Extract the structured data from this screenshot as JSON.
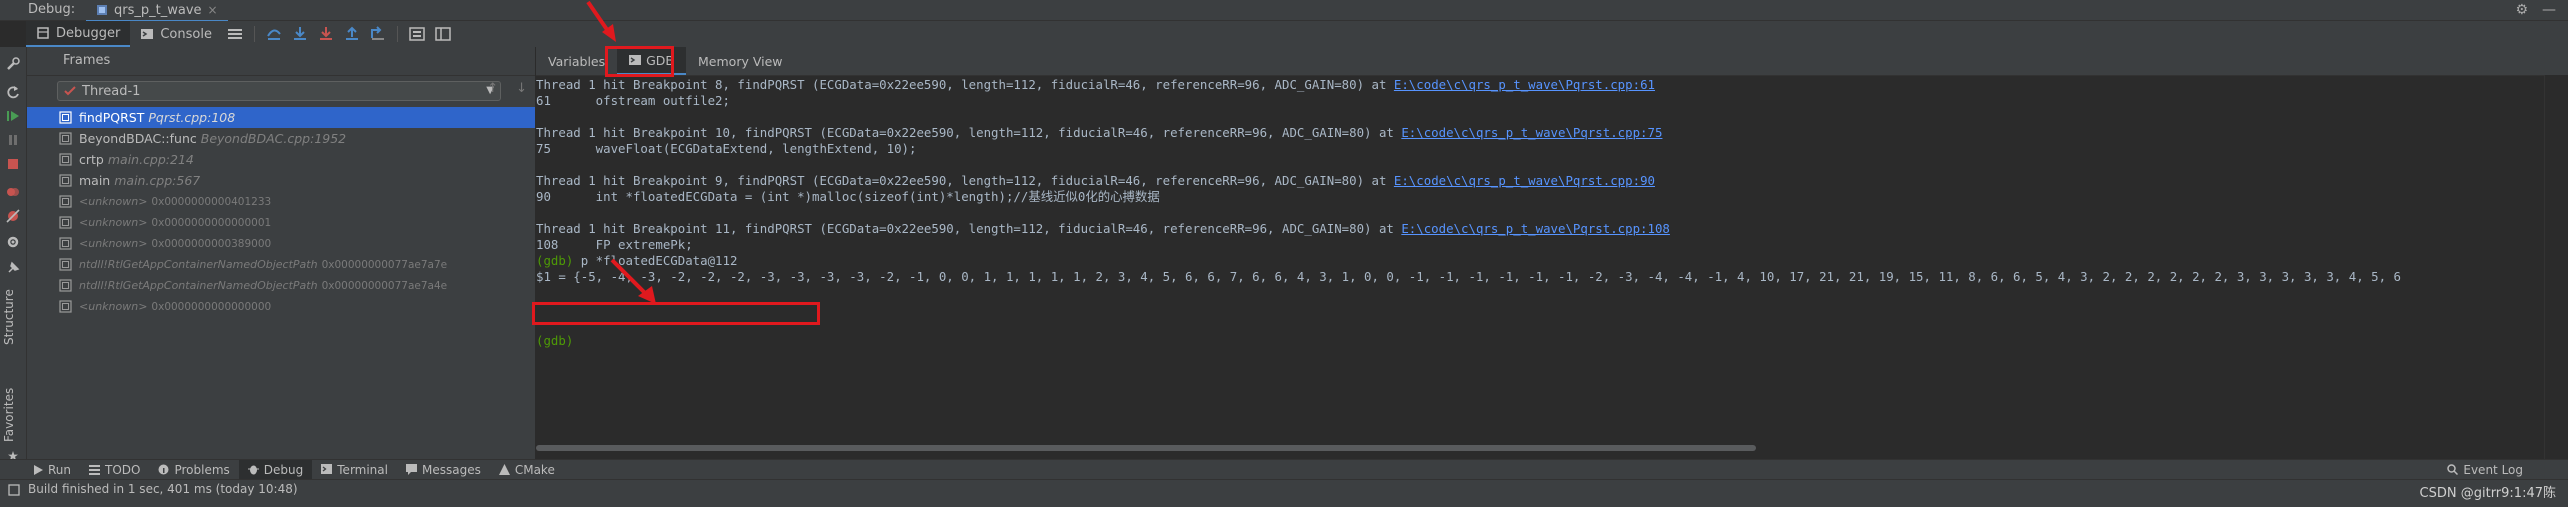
{
  "titlebar": {
    "debug_label": "Debug:",
    "tab_label": "qrs_p_t_wave",
    "tab_close": "×"
  },
  "toolbar": {
    "debugger_tab": "Debugger",
    "console_tab": "Console"
  },
  "frames_panel": {
    "header": "Frames",
    "thread_label": "Thread-1",
    "frames": [
      {
        "name": "findPQRST",
        "loc": "Pqrst.cpp:108",
        "selected": true
      },
      {
        "name": "BeyondBDAC::func",
        "loc": "BeyondBDAC.cpp:1952"
      },
      {
        "name": "crtp",
        "loc": "main.cpp:214"
      },
      {
        "name": "main",
        "loc": "main.cpp:567"
      },
      {
        "name": "<unknown>",
        "loc": "0x0000000000401233"
      },
      {
        "name": "<unknown>",
        "loc": "0x0000000000000001"
      },
      {
        "name": "<unknown>",
        "loc": "0x0000000000389000"
      },
      {
        "name": "ntdll!RtlGetAppContainerNamedObjectPath",
        "loc": "0x00000000077ae7a7e"
      },
      {
        "name": "ntdll!RtlGetAppContainerNamedObjectPath",
        "loc": "0x00000000077ae7a4e"
      },
      {
        "name": "<unknown>",
        "loc": "0x0000000000000000"
      }
    ]
  },
  "sidebar": {
    "structure_label": "Structure",
    "favorites_label": "Favorites"
  },
  "subtabs": {
    "variables": "Variables",
    "gdb": "GDB",
    "memory_view": "Memory View"
  },
  "console": {
    "lines": [
      {
        "text": "Thread 1 hit Breakpoint 8, findPQRST (ECGData=0x22ee590, length=112, fiducialR=46, referenceRR=96, ADC_GAIN=80) at ",
        "link": "E:\\code\\c\\qrs_p_t_wave\\Pqrst.cpp:61"
      },
      {
        "text": "61      ofstream outfile2;"
      },
      {
        "text": ""
      },
      {
        "text": "Thread 1 hit Breakpoint 10, findPQRST (ECGData=0x22ee590, length=112, fiducialR=46, referenceRR=96, ADC_GAIN=80) at ",
        "link": "E:\\code\\c\\qrs_p_t_wave\\Pqrst.cpp:75"
      },
      {
        "text": "75      waveFloat(ECGDataExtend, lengthExtend, 10);"
      },
      {
        "text": ""
      },
      {
        "text": "Thread 1 hit Breakpoint 9, findPQRST (ECGData=0x22ee590, length=112, fiducialR=46, referenceRR=96, ADC_GAIN=80) at ",
        "link": "E:\\code\\c\\qrs_p_t_wave\\Pqrst.cpp:90"
      },
      {
        "text": "90      int *floatedECGData = (int *)malloc(sizeof(int)*length);//基线近似0化的心搏数据"
      },
      {
        "text": ""
      },
      {
        "text": "Thread 1 hit Breakpoint 11, findPQRST (ECGData=0x22ee590, length=112, fiducialR=46, referenceRR=96, ADC_GAIN=80) at ",
        "link": "E:\\code\\c\\qrs_p_t_wave\\Pqrst.cpp:108"
      },
      {
        "text": "108     FP extremePk;"
      },
      {
        "prompt": "(gdb) ",
        "text": "p *floatedECGData@112"
      },
      {
        "text": "$1 = {-5, -4, -3, -2, -2, -2, -3, -3, -3, -3, -2, -1, 0, 0, 1, 1, 1, 1, 1, 2, 3, 4, 5, 6, 6, 7, 6, 6, 4, 3, 1, 0, 0, -1, -1, -1, -1, -1, -1, -2, -3, -4, -4, -1, 4, 10, 17, 21, 21, 19, 15, 11, 8, 6, 6, 5, 4, 3, 2, 2, 2, 2, 2, 2, 3, 3, 3, 3, 3, 4, 5, 6"
      },
      {
        "text": ""
      },
      {
        "text": ""
      },
      {
        "text": ""
      },
      {
        "prompt": "(gdb)",
        "text": ""
      }
    ]
  },
  "bottombar": {
    "run": "Run",
    "todo": "TODO",
    "problems": "Problems",
    "debug": "Debug",
    "terminal": "Terminal",
    "messages": "Messages",
    "cmake": "CMake",
    "event_log": "Event Log"
  },
  "status": {
    "message": "Build finished in 1 sec, 401 ms (today 10:48)",
    "watermark": "CSDN @gitrr9:1:47陈"
  },
  "colors": {
    "accent": "#4a88c7",
    "highlight": "#e0191e",
    "selected": "#2f65ca",
    "link": "#5794ff",
    "prompt": "#4e9a06"
  }
}
